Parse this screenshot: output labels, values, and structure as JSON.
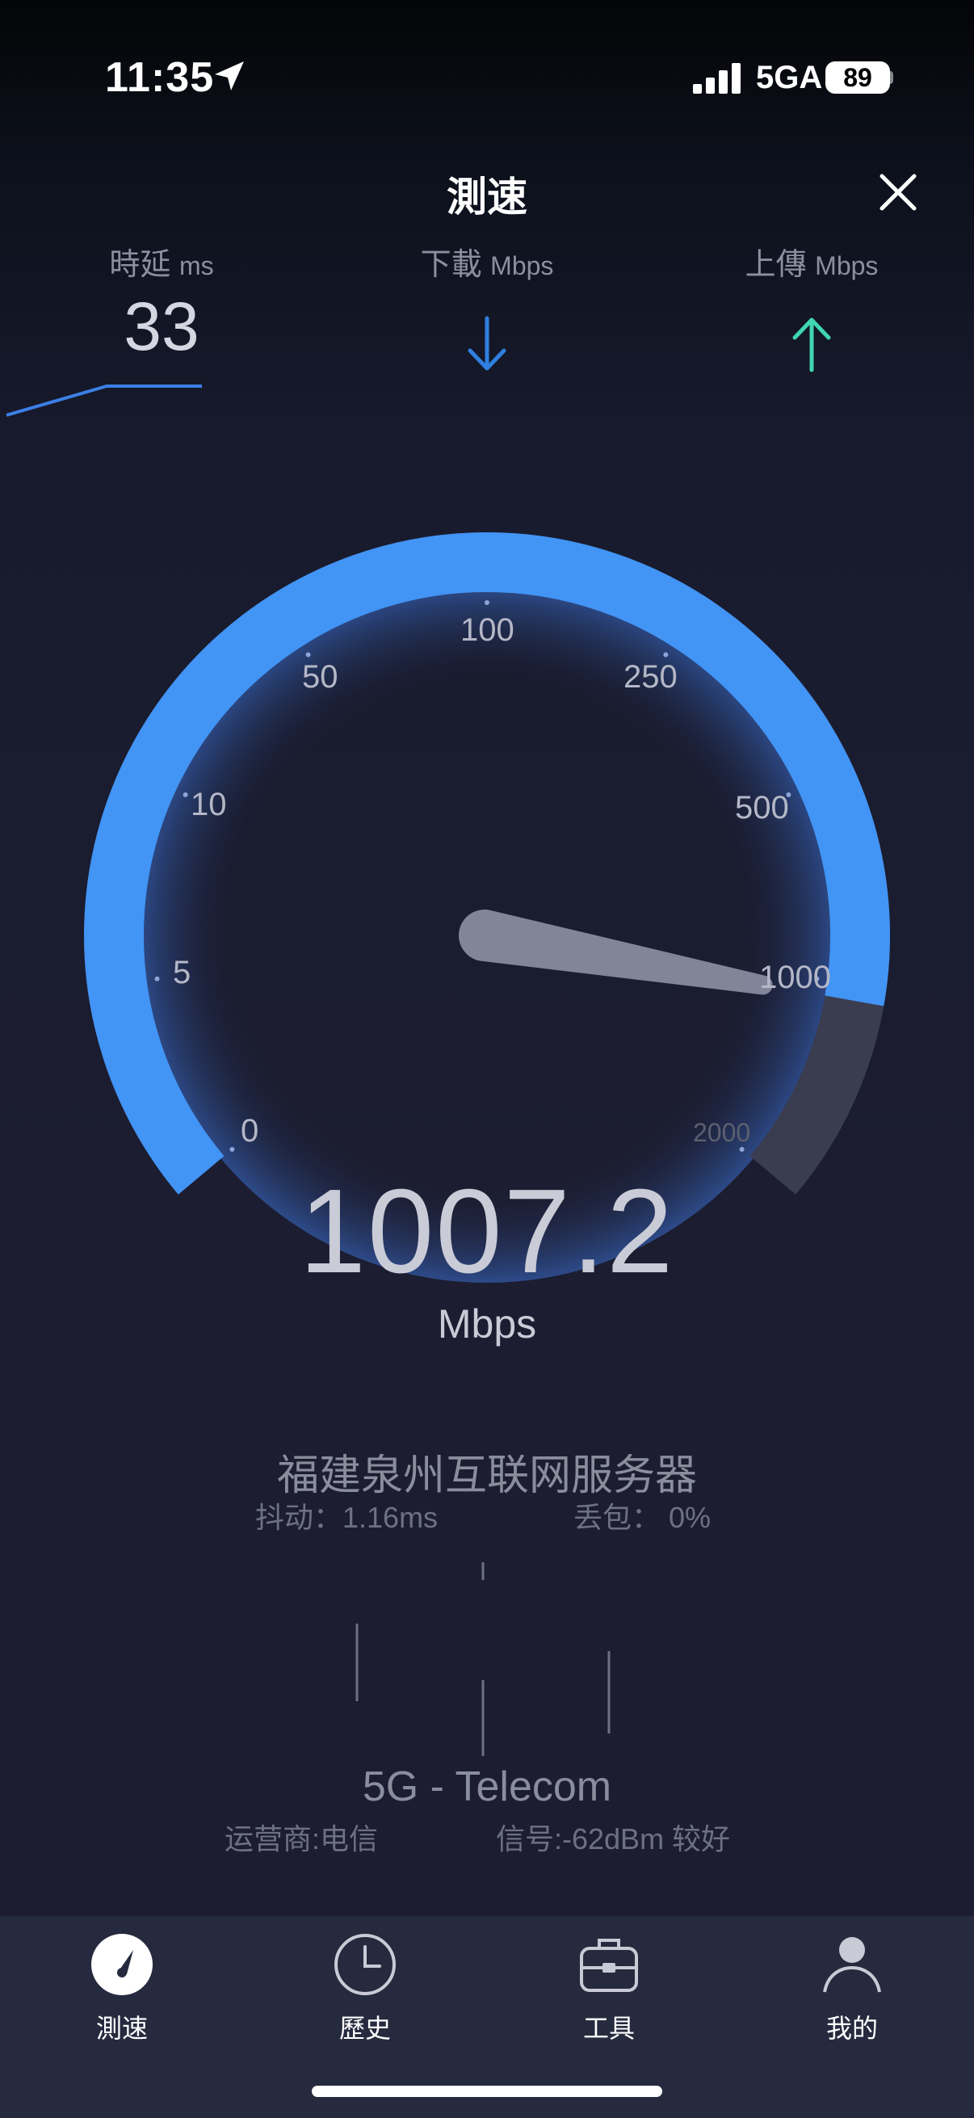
{
  "status_bar": {
    "time": "11:35",
    "network": "5GA",
    "battery": "89"
  },
  "header": {
    "title": "測速",
    "close_icon": "close-icon"
  },
  "metrics": {
    "latency": {
      "label": "時延",
      "unit": "ms",
      "value": "33"
    },
    "download": {
      "label": "下載",
      "unit": "Mbps",
      "icon": "arrow-down-icon",
      "color": "#2f7fe0"
    },
    "upload": {
      "label": "上傳",
      "unit": "Mbps",
      "icon": "arrow-up-icon",
      "color": "#3fd6b0"
    }
  },
  "gauge": {
    "ticks": [
      "0",
      "5",
      "10",
      "50",
      "100",
      "250",
      "500",
      "1000",
      "2000"
    ],
    "value": "1007.2",
    "unit": "Mbps",
    "accent": "#4294f5",
    "fraction": 0.885
  },
  "server": {
    "name": "福建泉州互联网服务器",
    "jitter": "抖动：1.16ms",
    "loss": "丢包： 0%"
  },
  "network": {
    "name": "5G - Telecom",
    "carrier": "运营商:电信",
    "signal": "信号:-62dBm 较好"
  },
  "tabs": [
    {
      "label": "測速",
      "icon": "speedometer-icon"
    },
    {
      "label": "歷史",
      "icon": "clock-icon"
    },
    {
      "label": "工具",
      "icon": "toolbox-icon"
    },
    {
      "label": "我的",
      "icon": "user-icon"
    }
  ]
}
